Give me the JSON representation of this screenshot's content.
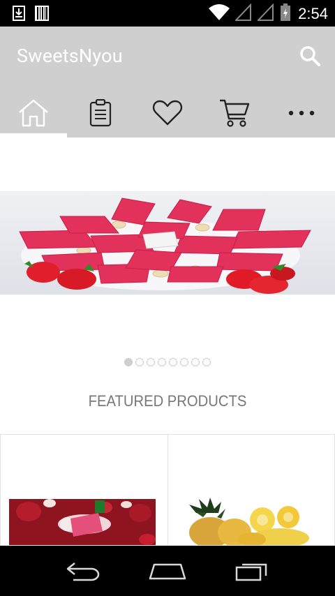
{
  "status_bar": {
    "time": "2:54",
    "left_icons": [
      "download-notification-icon",
      "barcode-notification-icon"
    ],
    "right_icons": [
      "wifi-icon",
      "signal-icon",
      "signal-icon",
      "battery-icon"
    ]
  },
  "app_bar": {
    "title": "SweetsNyou",
    "background": "#cfcfcf",
    "actions": [
      "search-icon"
    ]
  },
  "tabs": [
    {
      "icon": "home-icon",
      "selected": true
    },
    {
      "icon": "clipboard-icon",
      "selected": false
    },
    {
      "icon": "heart-icon",
      "selected": false
    },
    {
      "icon": "cart-icon",
      "selected": false
    },
    {
      "icon": "more-horizontal-icon",
      "selected": false
    }
  ],
  "carousel": {
    "slide_count": 8,
    "active_index": 0
  },
  "featured": {
    "heading": "FEATURED PRODUCTS"
  },
  "nav_bar": {
    "buttons": [
      "back-icon",
      "home-nav-icon",
      "recents-icon"
    ]
  }
}
